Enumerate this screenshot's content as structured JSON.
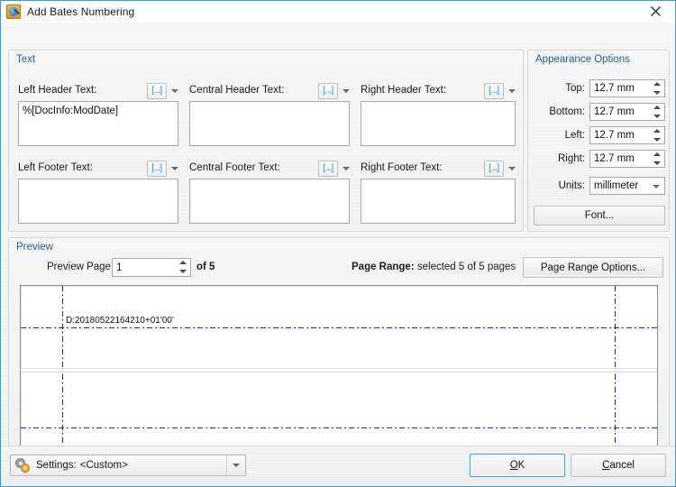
{
  "window": {
    "title": "Add Bates Numbering",
    "icon": "bates-stamp-icon",
    "close_icon": "close-icon",
    "accent_color": "#3a9ad9",
    "legend_color": "#2b5c85"
  },
  "text_group": {
    "legend": "Text",
    "macro_button_glyph": "[...]",
    "macro_button_name": "macro-insert-button",
    "fields": [
      {
        "label": "Left Header Text:",
        "value": "%[DocInfo:ModDate]",
        "name": "left-header-text"
      },
      {
        "label": "Central Header Text:",
        "value": "",
        "name": "central-header-text"
      },
      {
        "label": "Right Header Text:",
        "value": "",
        "name": "right-header-text"
      },
      {
        "label": "Left Footer Text:",
        "value": "",
        "name": "left-footer-text"
      },
      {
        "label": "Central Footer Text:",
        "value": "",
        "name": "central-footer-text"
      },
      {
        "label": "Right Footer Text:",
        "value": "",
        "name": "right-footer-text"
      }
    ]
  },
  "appearance": {
    "legend": "Appearance Options",
    "margins": [
      {
        "label": "Top:",
        "value": "12.7 mm"
      },
      {
        "label": "Bottom:",
        "value": "12.7 mm"
      },
      {
        "label": "Left:",
        "value": "12.7 mm"
      },
      {
        "label": "Right:",
        "value": "12.7 mm"
      }
    ],
    "units_label": "Units:",
    "units_value": "millimeter",
    "font_button": "Font..."
  },
  "preview": {
    "legend": "Preview",
    "page_label": "Preview Page",
    "page_value": "1",
    "of_label": "of 5",
    "page_range_prefix": "Page Range:",
    "page_range_value": " selected 5 of 5 pages",
    "page_range_button": "Page Range Options...",
    "rendered_header_text": "D:20180522164210+01'00'",
    "guide_color": "#2222dd"
  },
  "footer": {
    "settings_icon": "gears-icon",
    "settings_label": "Settings:",
    "settings_value": "<Custom>",
    "ok_button": {
      "pre": "",
      "accel": "O",
      "post": "K"
    },
    "cancel_button": {
      "pre": "",
      "accel": "C",
      "post": "ancel"
    }
  }
}
